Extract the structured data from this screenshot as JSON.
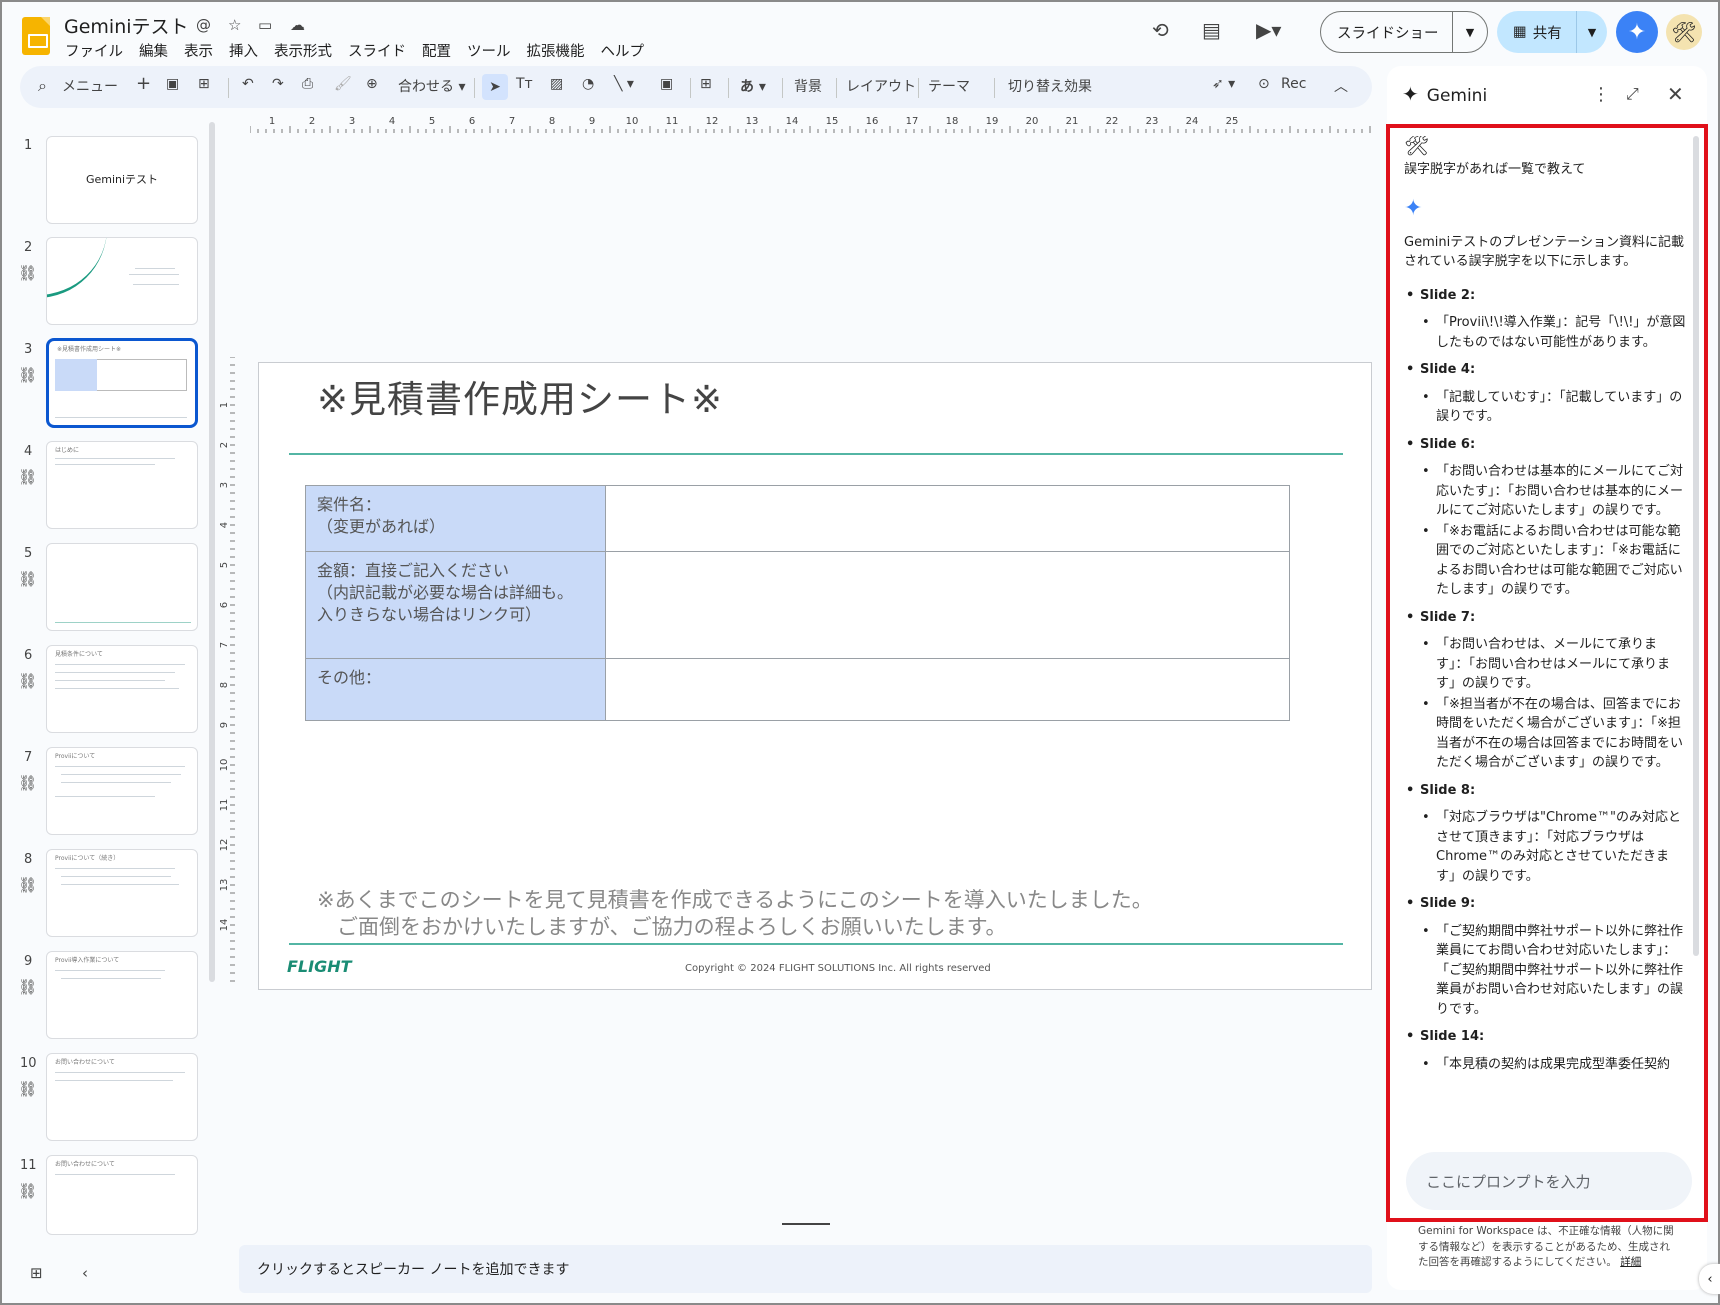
{
  "header": {
    "title": "Geminiテスト",
    "menu": [
      "ファイル",
      "編集",
      "表示",
      "挿入",
      "表示形式",
      "スライド",
      "配置",
      "ツール",
      "拡張機能",
      "ヘルプ"
    ],
    "slideshow_label": "スライドショー",
    "share_label": "共有"
  },
  "toolbar": {
    "menu_search": "メニュー",
    "zoom_label": "合わせる",
    "background": "背景",
    "layout": "レイアウト",
    "theme": "テーマ",
    "transition": "切り替え効果",
    "rec": "Rec"
  },
  "filmstrip": {
    "slides": [
      {
        "number": "1",
        "title": "Geminiテスト"
      },
      {
        "number": "2",
        "title": ""
      },
      {
        "number": "3",
        "title": "※見積書作成用シート※"
      },
      {
        "number": "4",
        "title": "はじめに"
      },
      {
        "number": "5",
        "title": ""
      },
      {
        "number": "6",
        "title": "見積条件について"
      },
      {
        "number": "7",
        "title": "Proviiについて"
      },
      {
        "number": "8",
        "title": "Proviiについて（続き）"
      },
      {
        "number": "9",
        "title": "Provii導入作業について"
      },
      {
        "number": "10",
        "title": "お問い合わせについて"
      },
      {
        "number": "11",
        "title": "お問い合わせについて"
      }
    ]
  },
  "ruler": {
    "top": [
      "1",
      "2",
      "3",
      "4",
      "5",
      "6",
      "7",
      "8",
      "9",
      "10",
      "11",
      "12",
      "13",
      "14",
      "15",
      "16",
      "17",
      "18",
      "19",
      "20",
      "21",
      "22",
      "23",
      "24",
      "25"
    ],
    "left": [
      "1",
      "2",
      "3",
      "4",
      "5",
      "6",
      "7",
      "8",
      "9",
      "10",
      "11",
      "12",
      "13",
      "14"
    ]
  },
  "slide": {
    "title": "※見積書作成用シート※",
    "table": [
      {
        "label_line1": "案件名：",
        "label_line2": "（変更があれば）",
        "label_line3": ""
      },
      {
        "label_line1": "金額：直接ご記入ください",
        "label_line2": "（内訳記載が必要な場合は詳細も。",
        "label_line3": "入りきらない場合はリンク可）"
      },
      {
        "label_line1": "その他：",
        "label_line2": "",
        "label_line3": ""
      }
    ],
    "note_line1": "※あくまでこのシートを見て見積書を作成できるようにこのシートを導入いたしました。",
    "note_line2": "ご面倒をおかけいたしますが、ご協力の程よろしくお願いいたします。",
    "logo_text": "FLIGHT",
    "copyright": "Copyright ©  2024 FLIGHT SOLUTIONS Inc. All rights reserved"
  },
  "speaker_notes_placeholder": "クリックするとスピーカー ノートを追加できます",
  "gemini": {
    "title": "Gemini",
    "user_prompt": "誤字脱字があれば一覧で教えて",
    "intro": "Geminiテストのプレゼンテーション資料に記載されている誤字脱字を以下に示します。",
    "sections": [
      {
        "heading": "Slide 2:",
        "items": [
          "「Provii\\!\\!導入作業」：記号「\\!\\!」が意図したものではない可能性があります。"
        ]
      },
      {
        "heading": "Slide 4:",
        "items": [
          "「記載していむす」：「記載しています」の誤りです。"
        ]
      },
      {
        "heading": "Slide 6:",
        "items": [
          "「お問い合わせは基本的にメールにてご対応いたす」：「お問い合わせは基本的にメールにてご対応いたします」の誤りです。",
          "「※お電話によるお問い合わせは可能な範囲でのご対応といたします」：「※お電話によるお問い合わせは可能な範囲でご対応いたします」の誤りです。"
        ]
      },
      {
        "heading": "Slide 7:",
        "items": [
          "「お問い合わせは、メールにて承ります」：「お問い合わせはメールにて承ります」の誤りです。",
          "「※担当者が不在の場合は、回答までにお時間をいただく場合がございます」：「※担当者が不在の場合は回答までにお時間をいただく場合がございます」の誤りです。"
        ]
      },
      {
        "heading": "Slide 8:",
        "items": [
          "「対応ブラウザは\"Chrome™\"のみ対応とさせて頂きます」：「対応ブラウザはChrome™のみ対応とさせていただきます」の誤りです。"
        ]
      },
      {
        "heading": "Slide 9:",
        "items": [
          "「ご契約期間中弊社サポート以外に弊社作業員にてお問い合わせ対応いたします」：「ご契約期間中弊社サポート以外に弊社作業員がお問い合わせ対応いたします」の誤りです。"
        ]
      },
      {
        "heading": "Slide 14:",
        "items": [
          "「本見積の契約は成果完成型準委任契約"
        ]
      }
    ],
    "prompt_placeholder": "ここにプロンプトを入力",
    "disclaimer": "Gemini for Workspace は、不正確な情報（人物に関する情報など）を表示することがあるため、生成された回答を再確認するようにしてください。",
    "disclaimer_link": "詳細"
  }
}
